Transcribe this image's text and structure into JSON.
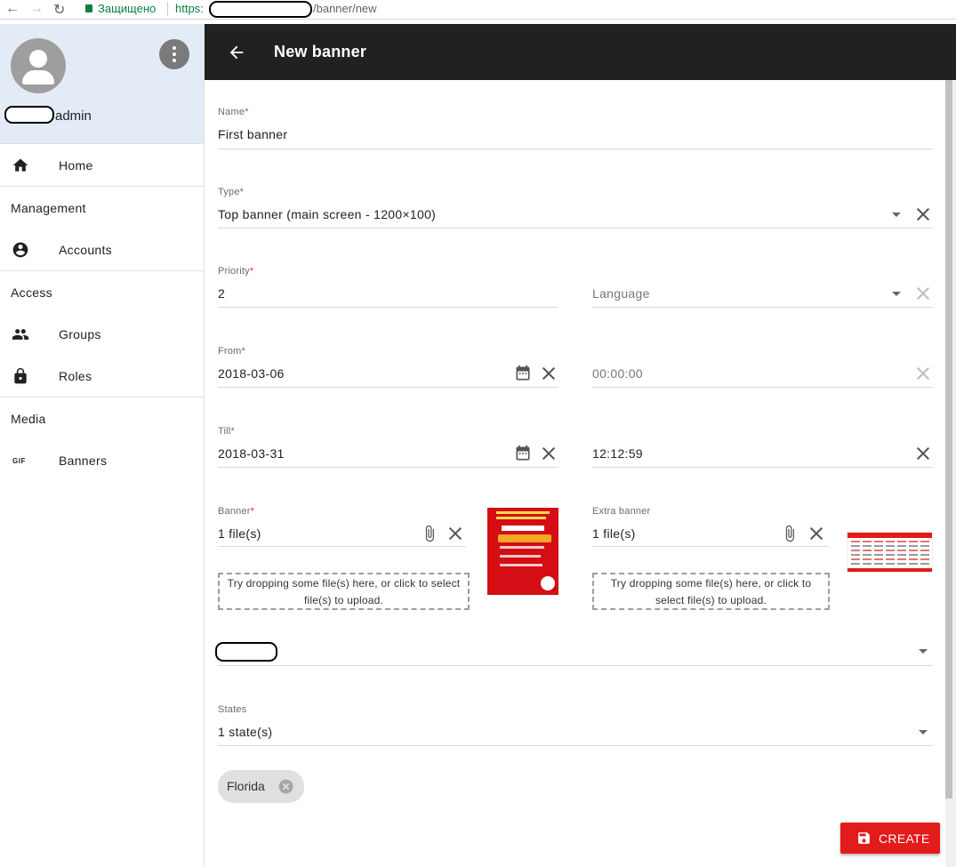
{
  "browser": {
    "secure_label": "Защищено",
    "url_scheme": "https:",
    "url_path": "/banner/new"
  },
  "sidebar": {
    "username": "admin",
    "items": [
      {
        "label": "Home",
        "icon": "home-icon"
      },
      {
        "header": "Management"
      },
      {
        "label": "Accounts",
        "icon": "account-circle-icon"
      },
      {
        "header": "Access"
      },
      {
        "label": "Groups",
        "icon": "group-icon"
      },
      {
        "label": "Roles",
        "icon": "lock-icon"
      },
      {
        "header": "Media"
      },
      {
        "label": "Banners",
        "icon": "gif-icon"
      }
    ],
    "home_label": "Home",
    "management_header": "Management",
    "accounts_label": "Accounts",
    "access_header": "Access",
    "groups_label": "Groups",
    "roles_label": "Roles",
    "media_header": "Media",
    "banners_label": "Banners",
    "gif_text": "GIF"
  },
  "appbar": {
    "title": "New banner"
  },
  "form": {
    "name": {
      "label": "Name*",
      "value": "First banner"
    },
    "type": {
      "label": "Type*",
      "value": "Top banner (main screen - 1200×100)"
    },
    "priority": {
      "label": "Priority",
      "required_mark": "*",
      "value": "2"
    },
    "language": {
      "placeholder": "Language"
    },
    "from": {
      "label": "From*",
      "date": "2018-03-06",
      "time": "00:00:00"
    },
    "till": {
      "label": "Till*",
      "date": "2018-03-31",
      "time": "12:12:59"
    },
    "banner": {
      "label": "Banner",
      "required_mark": "*",
      "value": "1 file(s)",
      "dropzone_line1": "Try dropping some file(s) here, or click to select",
      "dropzone_line2": "file(s) to upload."
    },
    "extra_banner": {
      "label": "Extra banner",
      "value": "1 file(s)",
      "dropzone_line1": "Try dropping some file(s) here, or click to",
      "dropzone_line2": "select file(s) to upload."
    },
    "states": {
      "label": "States",
      "value": "1 state(s)"
    },
    "chips": [
      "Florida"
    ]
  },
  "actions": {
    "create_label": "CREATE"
  },
  "colors": {
    "appbar": "#212121",
    "accent": "#e21b1b",
    "sidebar_header": "#e3ebf7"
  }
}
